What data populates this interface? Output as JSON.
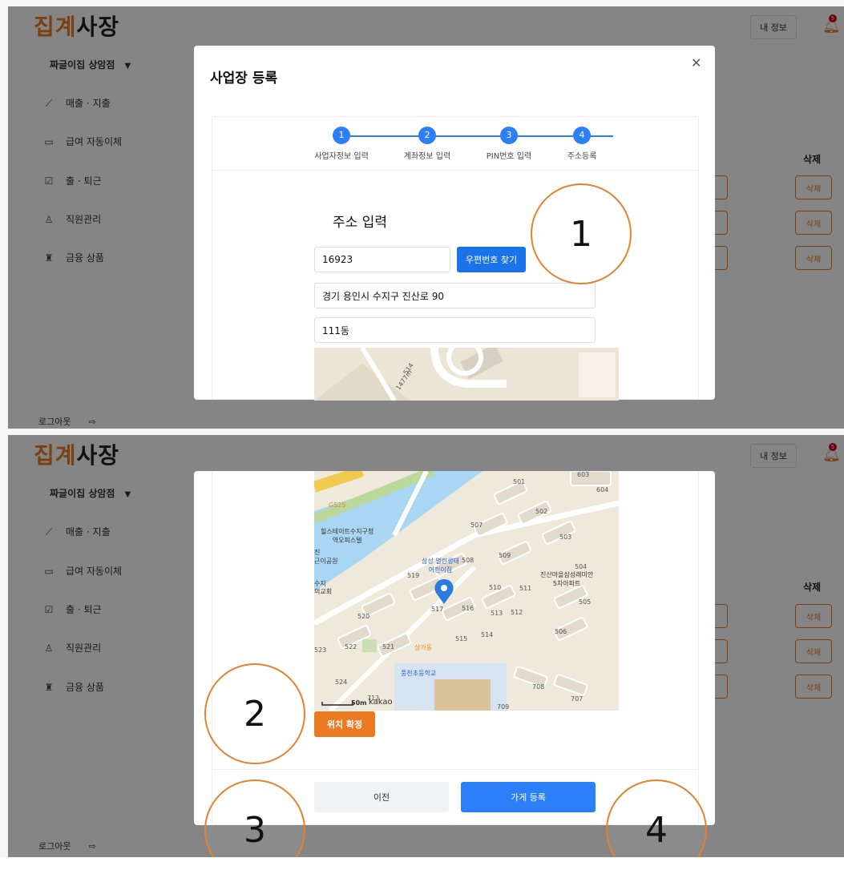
{
  "app": {
    "logo_orange": "집계",
    "logo_dark": "사장",
    "store_name": "짜글이집 상암점",
    "store_caret": "▼",
    "my_info": "내 정보",
    "bell_badge": "5",
    "logout": "로그아웃"
  },
  "sidebar": {
    "items": [
      {
        "label": "매출 · 지출",
        "icon": "chart-line-icon"
      },
      {
        "label": "급여 자동이체",
        "icon": "card-icon"
      },
      {
        "label": "출 · 퇴근",
        "icon": "calendar-check-icon"
      },
      {
        "label": "직원관리",
        "icon": "person-icon"
      },
      {
        "label": "금융 상품",
        "icon": "piggy-bank-icon"
      }
    ]
  },
  "table": {
    "delete_header": "삭제",
    "delete_label": "삭제"
  },
  "modal": {
    "title": "사업장 등록",
    "close": "✕",
    "steps": [
      {
        "num": "1",
        "label": "사업자정보 입력"
      },
      {
        "num": "2",
        "label": "계좌정보 입력"
      },
      {
        "num": "3",
        "label": "PIN번호 입력"
      },
      {
        "num": "4",
        "label": "주소등록"
      }
    ],
    "address_title": "주소 입력",
    "zipcode": "16923",
    "zip_button": "우편번호 찾기",
    "address": "경기 용인시 수지구 진산로 90",
    "detail": "111동",
    "confirm_location": "위치 확정",
    "prev": "이전",
    "register": "가게 등록"
  },
  "map": {
    "scale": "50m",
    "brand": "kakao",
    "labels_top": [
      "514",
      "1477m"
    ],
    "labels": {
      "gs25": "GS25",
      "officetel": "힐스테이트수지구청\n역오피스텔",
      "park": "진\n근이공원",
      "church_a": "수지",
      "church_b": "의교회",
      "daycare": "삼성 열린생태\n어린이집",
      "apt": "진산마을삼성래미안\n5차아파트",
      "mall": "상가동",
      "school": "풍천초등학교",
      "b501": "501",
      "b502": "502",
      "b503": "503",
      "b504": "504",
      "b505": "505",
      "b506": "506",
      "b507": "507",
      "b508": "508",
      "b509": "509",
      "b510": "510",
      "b511": "511",
      "b512": "512",
      "b513": "513",
      "b514": "514",
      "b515": "515",
      "b516": "516",
      "b517": "517",
      "b519": "519",
      "b520": "520",
      "b521": "521",
      "b522": "522",
      "b523": "523",
      "b524": "524",
      "b603": "603",
      "b604": "604",
      "b707": "707",
      "b708": "708",
      "b709": "709",
      "b712": "712"
    }
  },
  "callouts": [
    "1",
    "2",
    "3",
    "4"
  ]
}
